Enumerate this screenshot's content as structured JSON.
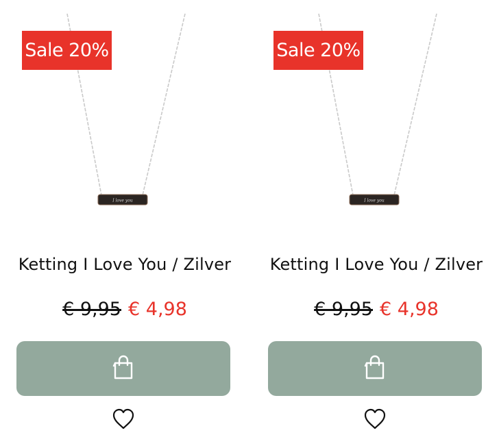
{
  "products": [
    {
      "badge": "Sale 20%",
      "image_text": "I love you",
      "title": "Ketting I Love You / Zilver",
      "old_price": "€ 9,95",
      "new_price": "€ 4,98",
      "cart_icon": "shopping-bag-icon",
      "wishlist_icon": "heart-icon"
    },
    {
      "badge": "Sale 20%",
      "image_text": "I love you",
      "title": "Ketting I Love You / Zilver",
      "old_price": "€ 9,95",
      "new_price": "€ 4,98",
      "cart_icon": "shopping-bag-icon",
      "wishlist_icon": "heart-icon"
    }
  ],
  "colors": {
    "sale_red": "#e8332a",
    "button_green": "#93a99d",
    "text": "#111111"
  }
}
